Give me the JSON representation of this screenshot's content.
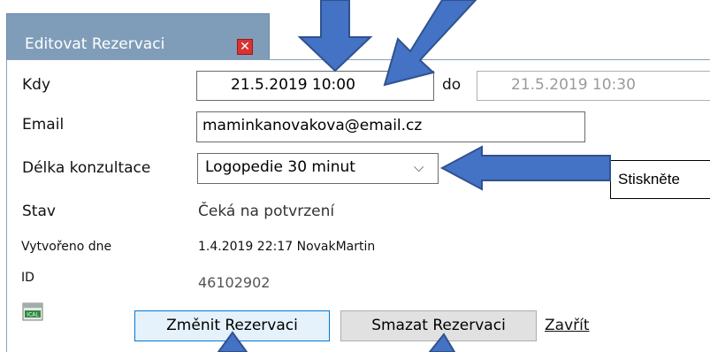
{
  "dialog": {
    "title": "Editovat Rezervaci",
    "close_glyph": "✕"
  },
  "form": {
    "kdy_label": "Kdy",
    "from_value": "21.5.2019  10:00",
    "do_label": "do",
    "to_value": "21.5.2019  10:30",
    "email_label": "Email",
    "email_value": "maminkanovakova@email.cz",
    "duration_label": "Délka konzultace",
    "duration_value": "Logopedie 30 minut",
    "duration_caret": "⌵",
    "stav_label": "Stav",
    "stav_value": "Čeká na potvrzení",
    "created_label": "Vytvořeno dne",
    "created_value": "1.4.2019 22:17 NovakMartin",
    "id_label": "ID",
    "id_value": "46102902"
  },
  "actions": {
    "change_label": "Změnit Rezervaci",
    "delete_label": "Smazat Rezervaci",
    "close_label": "Zavřít",
    "ical_label": "ICAL"
  },
  "annotation": {
    "callout_text": "Stiskněte",
    "arrow_color": "#4472c4"
  }
}
